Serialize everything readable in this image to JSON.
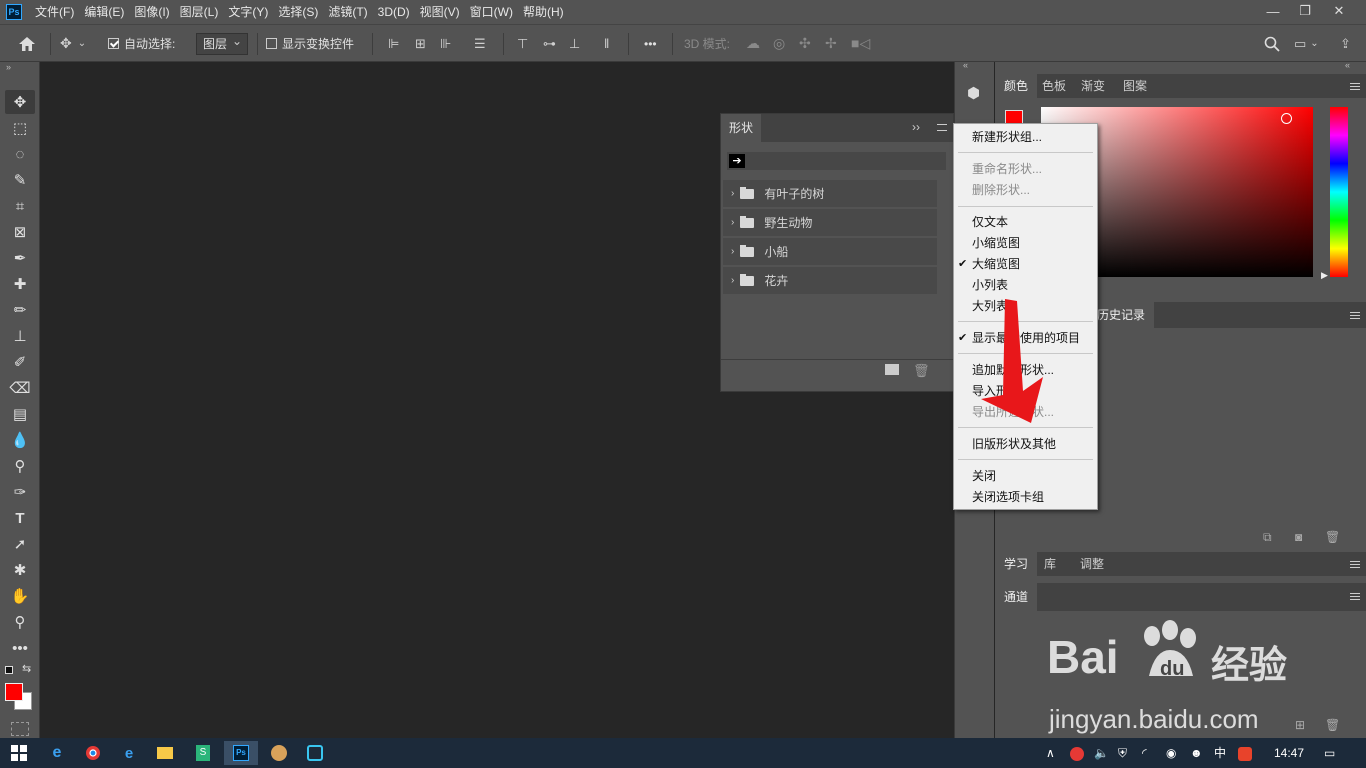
{
  "menubar": {
    "logo": "Ps",
    "items": [
      "文件(F)",
      "编辑(E)",
      "图像(I)",
      "图层(L)",
      "文字(Y)",
      "选择(S)",
      "滤镜(T)",
      "3D(D)",
      "视图(V)",
      "窗口(W)",
      "帮助(H)"
    ]
  },
  "options": {
    "auto_select_label": "自动选择:",
    "auto_select_value": "图层",
    "show_transform_label": "显示变换控件",
    "mode_3d_label": "3D 模式:",
    "more": "•••"
  },
  "shapes_panel": {
    "tab": "形状",
    "collapse": "››",
    "groups": [
      "有叶子的树",
      "野生动物",
      "小船",
      "花卉"
    ]
  },
  "context_menu": {
    "items": [
      {
        "label": "新建形状组...",
        "disabled": false,
        "checked": false
      },
      {
        "label": "重命名形状...",
        "disabled": true,
        "checked": false
      },
      {
        "label": "删除形状...",
        "disabled": true,
        "checked": false
      },
      {
        "label": "仅文本",
        "disabled": false,
        "checked": false
      },
      {
        "label": "小缩览图",
        "disabled": false,
        "checked": false
      },
      {
        "label": "大缩览图",
        "disabled": false,
        "checked": true
      },
      {
        "label": "小列表",
        "disabled": false,
        "checked": false
      },
      {
        "label": "大列表",
        "disabled": false,
        "checked": false
      },
      {
        "label": "显示最近使用的项目",
        "disabled": false,
        "checked": true
      },
      {
        "label": "追加默认形状...",
        "disabled": false,
        "checked": false
      },
      {
        "label": "导入形状...",
        "disabled": false,
        "checked": false
      },
      {
        "label": "导出所选形状...",
        "disabled": true,
        "checked": false
      },
      {
        "label": "旧版形状及其他",
        "disabled": false,
        "checked": false
      },
      {
        "label": "关闭",
        "disabled": false,
        "checked": false
      },
      {
        "label": "关闭选项卡组",
        "disabled": false,
        "checked": false
      }
    ]
  },
  "right_panels": {
    "color_tabs": [
      "颜色",
      "色板",
      "渐变",
      "图案"
    ],
    "history_tab": "历史记录",
    "learn_tabs": [
      "学习",
      "库",
      "调整"
    ],
    "channels_tab": "通道"
  },
  "colors": {
    "foreground": "#ff0000",
    "background": "#ffffff",
    "accent_ps": "#31a8ff",
    "arrow": "#e8171a"
  },
  "taskbar": {
    "time": "14:47",
    "ime": "中"
  },
  "watermark": {
    "brand": "Bai",
    "brand_suffix": "经验",
    "url": "jingyan.baidu.com"
  }
}
